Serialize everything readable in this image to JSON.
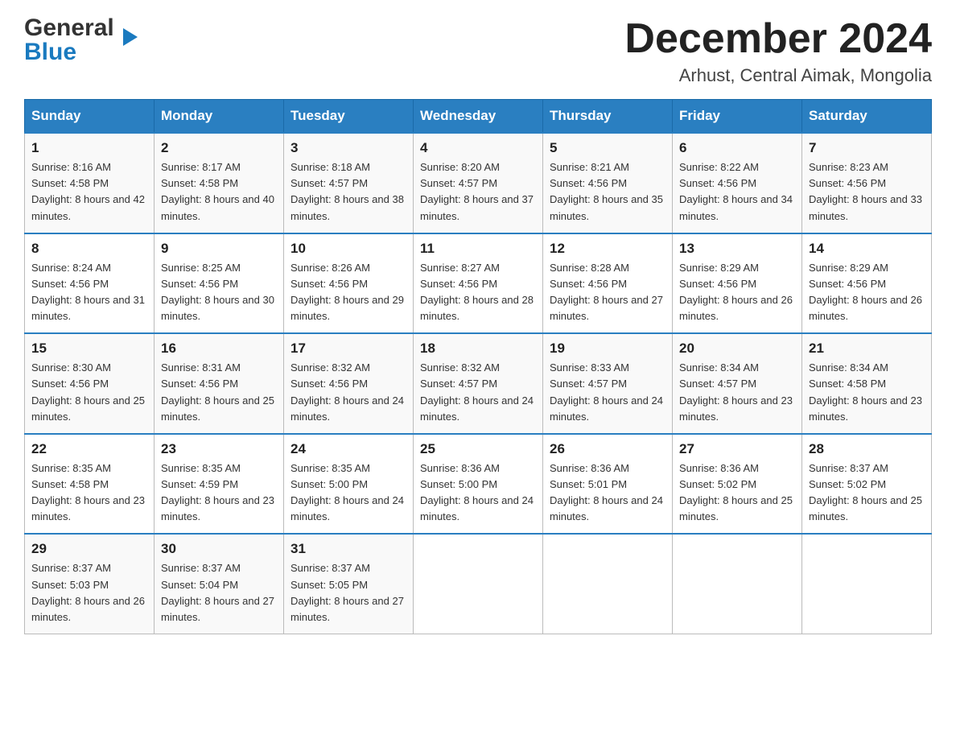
{
  "logo": {
    "line1_black": "General",
    "arrow": "▶",
    "line2_blue": "Blue"
  },
  "title": "December 2024",
  "location": "Arhust, Central Aimak, Mongolia",
  "days_of_week": [
    "Sunday",
    "Monday",
    "Tuesday",
    "Wednesday",
    "Thursday",
    "Friday",
    "Saturday"
  ],
  "weeks": [
    [
      {
        "day": "1",
        "sunrise": "8:16 AM",
        "sunset": "4:58 PM",
        "daylight": "8 hours and 42 minutes."
      },
      {
        "day": "2",
        "sunrise": "8:17 AM",
        "sunset": "4:58 PM",
        "daylight": "8 hours and 40 minutes."
      },
      {
        "day": "3",
        "sunrise": "8:18 AM",
        "sunset": "4:57 PM",
        "daylight": "8 hours and 38 minutes."
      },
      {
        "day": "4",
        "sunrise": "8:20 AM",
        "sunset": "4:57 PM",
        "daylight": "8 hours and 37 minutes."
      },
      {
        "day": "5",
        "sunrise": "8:21 AM",
        "sunset": "4:56 PM",
        "daylight": "8 hours and 35 minutes."
      },
      {
        "day": "6",
        "sunrise": "8:22 AM",
        "sunset": "4:56 PM",
        "daylight": "8 hours and 34 minutes."
      },
      {
        "day": "7",
        "sunrise": "8:23 AM",
        "sunset": "4:56 PM",
        "daylight": "8 hours and 33 minutes."
      }
    ],
    [
      {
        "day": "8",
        "sunrise": "8:24 AM",
        "sunset": "4:56 PM",
        "daylight": "8 hours and 31 minutes."
      },
      {
        "day": "9",
        "sunrise": "8:25 AM",
        "sunset": "4:56 PM",
        "daylight": "8 hours and 30 minutes."
      },
      {
        "day": "10",
        "sunrise": "8:26 AM",
        "sunset": "4:56 PM",
        "daylight": "8 hours and 29 minutes."
      },
      {
        "day": "11",
        "sunrise": "8:27 AM",
        "sunset": "4:56 PM",
        "daylight": "8 hours and 28 minutes."
      },
      {
        "day": "12",
        "sunrise": "8:28 AM",
        "sunset": "4:56 PM",
        "daylight": "8 hours and 27 minutes."
      },
      {
        "day": "13",
        "sunrise": "8:29 AM",
        "sunset": "4:56 PM",
        "daylight": "8 hours and 26 minutes."
      },
      {
        "day": "14",
        "sunrise": "8:29 AM",
        "sunset": "4:56 PM",
        "daylight": "8 hours and 26 minutes."
      }
    ],
    [
      {
        "day": "15",
        "sunrise": "8:30 AM",
        "sunset": "4:56 PM",
        "daylight": "8 hours and 25 minutes."
      },
      {
        "day": "16",
        "sunrise": "8:31 AM",
        "sunset": "4:56 PM",
        "daylight": "8 hours and 25 minutes."
      },
      {
        "day": "17",
        "sunrise": "8:32 AM",
        "sunset": "4:56 PM",
        "daylight": "8 hours and 24 minutes."
      },
      {
        "day": "18",
        "sunrise": "8:32 AM",
        "sunset": "4:57 PM",
        "daylight": "8 hours and 24 minutes."
      },
      {
        "day": "19",
        "sunrise": "8:33 AM",
        "sunset": "4:57 PM",
        "daylight": "8 hours and 24 minutes."
      },
      {
        "day": "20",
        "sunrise": "8:34 AM",
        "sunset": "4:57 PM",
        "daylight": "8 hours and 23 minutes."
      },
      {
        "day": "21",
        "sunrise": "8:34 AM",
        "sunset": "4:58 PM",
        "daylight": "8 hours and 23 minutes."
      }
    ],
    [
      {
        "day": "22",
        "sunrise": "8:35 AM",
        "sunset": "4:58 PM",
        "daylight": "8 hours and 23 minutes."
      },
      {
        "day": "23",
        "sunrise": "8:35 AM",
        "sunset": "4:59 PM",
        "daylight": "8 hours and 23 minutes."
      },
      {
        "day": "24",
        "sunrise": "8:35 AM",
        "sunset": "5:00 PM",
        "daylight": "8 hours and 24 minutes."
      },
      {
        "day": "25",
        "sunrise": "8:36 AM",
        "sunset": "5:00 PM",
        "daylight": "8 hours and 24 minutes."
      },
      {
        "day": "26",
        "sunrise": "8:36 AM",
        "sunset": "5:01 PM",
        "daylight": "8 hours and 24 minutes."
      },
      {
        "day": "27",
        "sunrise": "8:36 AM",
        "sunset": "5:02 PM",
        "daylight": "8 hours and 25 minutes."
      },
      {
        "day": "28",
        "sunrise": "8:37 AM",
        "sunset": "5:02 PM",
        "daylight": "8 hours and 25 minutes."
      }
    ],
    [
      {
        "day": "29",
        "sunrise": "8:37 AM",
        "sunset": "5:03 PM",
        "daylight": "8 hours and 26 minutes."
      },
      {
        "day": "30",
        "sunrise": "8:37 AM",
        "sunset": "5:04 PM",
        "daylight": "8 hours and 27 minutes."
      },
      {
        "day": "31",
        "sunrise": "8:37 AM",
        "sunset": "5:05 PM",
        "daylight": "8 hours and 27 minutes."
      },
      null,
      null,
      null,
      null
    ]
  ],
  "labels": {
    "sunrise": "Sunrise:",
    "sunset": "Sunset:",
    "daylight": "Daylight:"
  }
}
